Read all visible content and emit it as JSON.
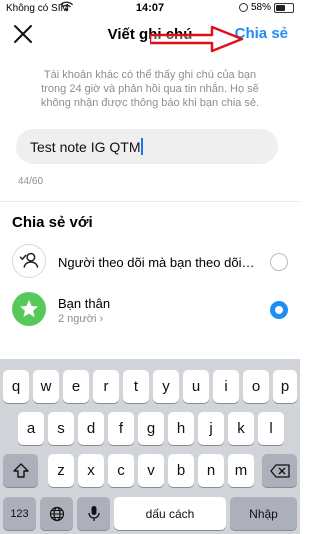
{
  "status_bar": {
    "carrier": "Không có SIM",
    "time": "14:07",
    "battery_text": "58%",
    "battery_level": 0.58
  },
  "header": {
    "title": "Viết ghi chú",
    "share_label": "Chia sẻ",
    "close_icon": "close-icon",
    "accent_color": "#1e8ef7",
    "annotation_arrow_color": "#e0101a"
  },
  "info_text": "Tài khoản khác có thể thấy ghi chú của bạn trong 24 giờ và phản hồi qua tin nhắn. Họ sẽ không nhận được thông báo khi bạn chia sẻ.",
  "note": {
    "value": "Test note IG QTM",
    "count": "44/60"
  },
  "share_with": {
    "title": "Chia sẻ với",
    "options": [
      {
        "label": "Người theo dõi mà bạn theo dõi lại",
        "selected": false,
        "icon": "followers-icon"
      },
      {
        "label": "Bạn thân",
        "sub": "2 người ›",
        "selected": true,
        "icon": "star-icon",
        "icon_color": "#59c85a"
      }
    ]
  },
  "keyboard": {
    "row1": [
      "q",
      "w",
      "e",
      "r",
      "t",
      "y",
      "u",
      "i",
      "o",
      "p"
    ],
    "row2": [
      "a",
      "s",
      "d",
      "f",
      "g",
      "h",
      "j",
      "k",
      "l"
    ],
    "row3": [
      "z",
      "x",
      "c",
      "v",
      "b",
      "n",
      "m"
    ],
    "numbers_label": "123",
    "space_label": "dấu cách",
    "return_label": "Nhập"
  }
}
